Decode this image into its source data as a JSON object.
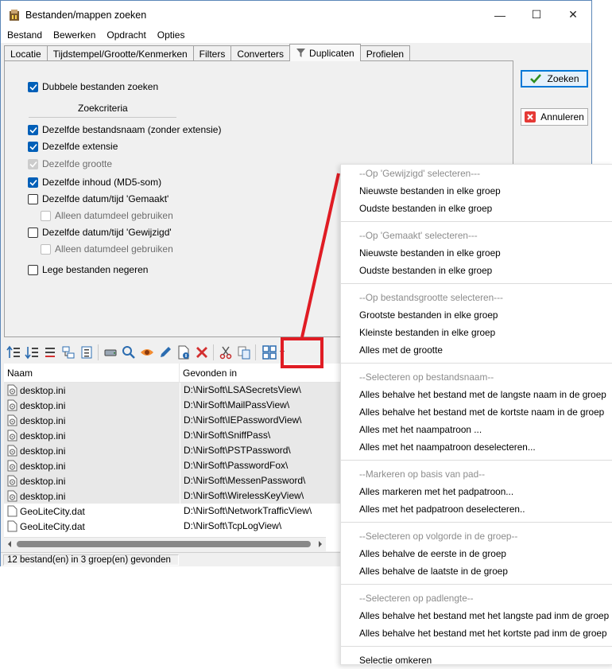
{
  "window": {
    "title": "Bestanden/mappen zoeken",
    "controls": {
      "minimize": "—",
      "maximize": "☐",
      "close": "✕"
    }
  },
  "menu": [
    "Bestand",
    "Bewerken",
    "Opdracht",
    "Opties"
  ],
  "tabs": [
    "Locatie",
    "Tijdstempel/Grootte/Kenmerken",
    "Filters",
    "Converters",
    "Duplicaten",
    "Profielen"
  ],
  "duplicates": {
    "main_check": {
      "label": "Dubbele bestanden zoeken",
      "checked": true
    },
    "criteria_title": "Zoekcriteria",
    "options": [
      {
        "label": "Dezelfde bestandsnaam (zonder extensie)",
        "state": "checked"
      },
      {
        "label": "Dezelfde extensie",
        "state": "checked"
      },
      {
        "label": "Dezelfde grootte",
        "state": "checked-disabled"
      },
      {
        "label": "Dezelfde inhoud (MD5-som)",
        "state": "checked"
      },
      {
        "label": "Dezelfde datum/tijd 'Gemaakt'",
        "state": "unchecked"
      },
      {
        "label": "Alleen datumdeel gebruiken",
        "state": "disabled"
      },
      {
        "label": "Dezelfde datum/tijd 'Gewijzigd'",
        "state": "unchecked"
      },
      {
        "label": "Alleen datumdeel gebruiken",
        "state": "disabled"
      },
      {
        "label": "Lege bestanden negeren",
        "state": "unchecked"
      }
    ]
  },
  "buttons": {
    "search": "Zoeken",
    "cancel": "Annuleren"
  },
  "list": {
    "columns": [
      "Naam",
      "Gevonden in"
    ],
    "rows": [
      {
        "name": "desktop.ini",
        "path": "D:\\NirSoft\\LSASecretsView\\",
        "shaded": true,
        "icon": "ini-file-icon"
      },
      {
        "name": "desktop.ini",
        "path": "D:\\NirSoft\\MailPassView\\",
        "shaded": true,
        "icon": "ini-file-icon"
      },
      {
        "name": "desktop.ini",
        "path": "D:\\NirSoft\\IEPasswordView\\",
        "shaded": true,
        "icon": "ini-file-icon"
      },
      {
        "name": "desktop.ini",
        "path": "D:\\NirSoft\\SniffPass\\",
        "shaded": true,
        "icon": "ini-file-icon"
      },
      {
        "name": "desktop.ini",
        "path": "D:\\NirSoft\\PSTPassword\\",
        "shaded": true,
        "icon": "ini-file-icon"
      },
      {
        "name": "desktop.ini",
        "path": "D:\\NirSoft\\PasswordFox\\",
        "shaded": true,
        "icon": "ini-file-icon"
      },
      {
        "name": "desktop.ini",
        "path": "D:\\NirSoft\\MessenPassword\\",
        "shaded": true,
        "icon": "ini-file-icon"
      },
      {
        "name": "desktop.ini",
        "path": "D:\\NirSoft\\WirelessKeyView\\",
        "shaded": true,
        "icon": "ini-file-icon"
      },
      {
        "name": "GeoLiteCity.dat",
        "path": "D:\\NirSoft\\NetworkTrafficView\\",
        "shaded": false,
        "icon": "blank-file-icon"
      },
      {
        "name": "GeoLiteCity.dat",
        "path": "D:\\NirSoft\\TcpLogView\\",
        "shaded": false,
        "icon": "blank-file-icon"
      }
    ]
  },
  "status": "12 bestand(en) in 3 groep(en) gevonden",
  "popup_menu": {
    "groups": [
      {
        "header": "--Op 'Gewijzigd' selecteren---",
        "items": [
          "Nieuwste bestanden in elke groep",
          "Oudste bestanden in elke groep"
        ]
      },
      {
        "header": "--Op 'Gemaakt' selecteren---",
        "items": [
          "Nieuwste bestanden in elke groep",
          "Oudste bestanden in elke groep"
        ]
      },
      {
        "header": "--Op bestandsgrootte selecteren---",
        "items": [
          "Grootste bestanden in elke groep",
          "Kleinste bestanden in elke groep",
          "Alles met de grootte"
        ]
      },
      {
        "header": "--Selecteren op bestandsnaam--",
        "items": [
          "Alles behalve het bestand met de langste naam in de groep",
          "Alles behalve het bestand met de kortste naam in de groep",
          "Alles met het naampatroon ...",
          "Alles met het naampatroon deselecteren..."
        ]
      },
      {
        "header": "--Markeren op basis van pad--",
        "items": [
          "Alles markeren met het padpatroon...",
          "Alles met het padpatroon deselecteren.."
        ]
      },
      {
        "header": "--Selecteren op volgorde in de groep--",
        "items": [
          "Alles behalve de eerste in de groep",
          "Alles behalve de laatste in de groep"
        ]
      },
      {
        "header": "--Selecteren op padlengte--",
        "items": [
          "Alles behalve het bestand met het langste pad inm de groep",
          "Alles behalve het bestand met het kortste pad inm de groep"
        ]
      },
      {
        "header": "",
        "items": [
          "Selectie omkeren"
        ]
      }
    ]
  },
  "colors": {
    "highlight_box": "#e01c24",
    "checkbox_on": "#005fb8",
    "accent": "#0078d7"
  }
}
